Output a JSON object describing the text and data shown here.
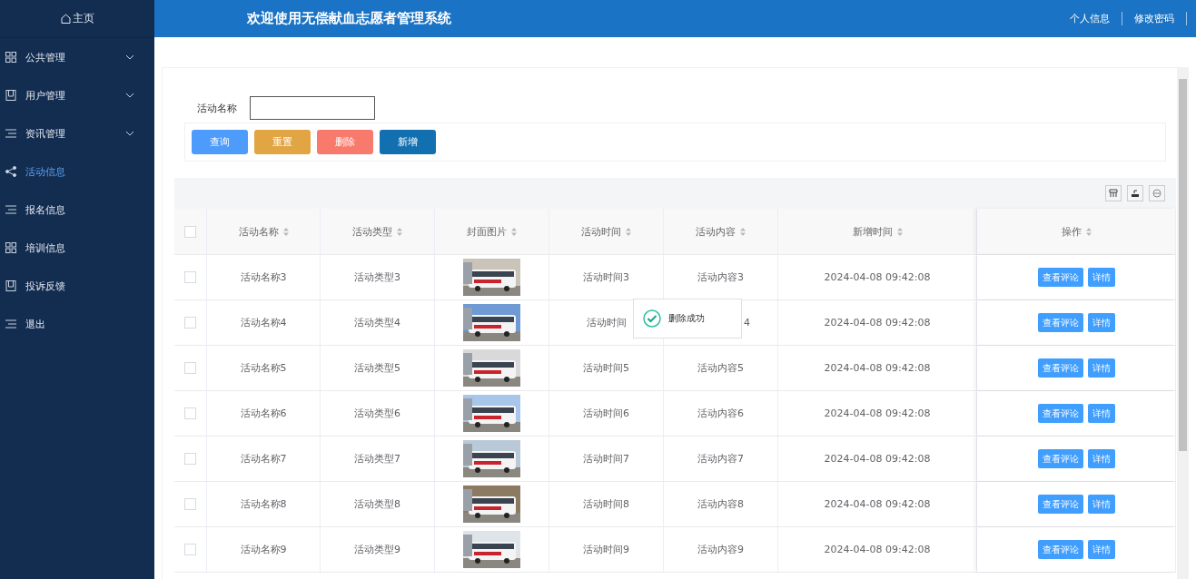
{
  "sidebar": {
    "home": "主页",
    "items": [
      {
        "label": "公共管理",
        "kind": "grid",
        "expandable": true,
        "selected": false
      },
      {
        "label": "用户管理",
        "kind": "book",
        "expandable": true,
        "selected": false
      },
      {
        "label": "资讯管理",
        "kind": "list",
        "expandable": true,
        "selected": false
      },
      {
        "label": "活动信息",
        "kind": "share",
        "expandable": false,
        "selected": true
      },
      {
        "label": "报名信息",
        "kind": "list",
        "expandable": false,
        "selected": false
      },
      {
        "label": "培训信息",
        "kind": "grid",
        "expandable": false,
        "selected": false
      },
      {
        "label": "投诉反馈",
        "kind": "book",
        "expandable": false,
        "selected": false
      },
      {
        "label": "退出",
        "kind": "list",
        "expandable": false,
        "selected": false
      }
    ]
  },
  "header": {
    "title": "欢迎使用无偿献血志愿者管理系统",
    "links": [
      "个人信息",
      "修改密码"
    ]
  },
  "search": {
    "label": "活动名称"
  },
  "buttons": [
    {
      "label": "查询",
      "kind": "query"
    },
    {
      "label": "重置",
      "kind": "reset"
    },
    {
      "label": "删除",
      "kind": "delete"
    },
    {
      "label": "新增",
      "kind": "add"
    }
  ],
  "table": {
    "all_checked": false,
    "columns": [
      "活动名称",
      "活动类型",
      "封面图片",
      "活动时间",
      "活动内容",
      "新增时间",
      "操作"
    ],
    "rows": [
      {
        "checked": false,
        "name": "活动名称3",
        "type": "活动类型3",
        "time": "活动时间3",
        "content": "活动内容3",
        "added": "2024-04-08 09:42:08",
        "actions": [
          "查看评论",
          "详情"
        ]
      },
      {
        "checked": false,
        "name": "活动名称4",
        "type": "活动类型4",
        "time": "活动时间",
        "content": "4",
        "added": "2024-04-08 09:42:08",
        "actions": [
          "查看评论",
          "详情"
        ]
      },
      {
        "checked": false,
        "name": "活动名称5",
        "type": "活动类型5",
        "time": "活动时间5",
        "content": "活动内容5",
        "added": "2024-04-08 09:42:08",
        "actions": [
          "查看评论",
          "详情"
        ]
      },
      {
        "checked": false,
        "name": "活动名称6",
        "type": "活动类型6",
        "time": "活动时间6",
        "content": "活动内容6",
        "added": "2024-04-08 09:42:08",
        "actions": [
          "查看评论",
          "详情"
        ]
      },
      {
        "checked": false,
        "name": "活动名称7",
        "type": "活动类型7",
        "time": "活动时间7",
        "content": "活动内容7",
        "added": "2024-04-08 09:42:08",
        "actions": [
          "查看评论",
          "详情"
        ]
      },
      {
        "checked": false,
        "name": "活动名称8",
        "type": "活动类型8",
        "time": "活动时间8",
        "content": "活动内容8",
        "added": "2024-04-08 09:42:08",
        "actions": [
          "查看评论",
          "详情"
        ]
      },
      {
        "checked": false,
        "name": "活动名称9",
        "type": "活动类型9",
        "time": "活动时间9",
        "content": "活动内容9",
        "added": "2024-04-08 09:42:08",
        "actions": [
          "查看评论",
          "详情"
        ]
      }
    ]
  },
  "toast": {
    "message": "删除成功"
  }
}
